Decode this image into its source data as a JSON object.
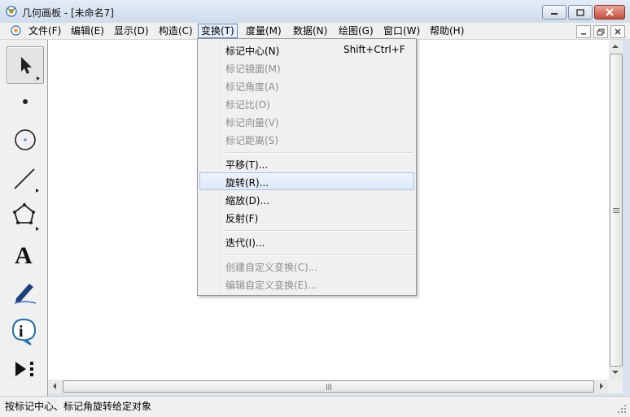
{
  "window": {
    "title": "几何画板 - [未命名7]"
  },
  "menubar": {
    "items": [
      "文件(F)",
      "编辑(E)",
      "显示(D)",
      "构造(C)",
      "变换(T)",
      "度量(M)",
      "数据(N)",
      "绘图(G)",
      "窗口(W)",
      "帮助(H)"
    ],
    "active_index": 4
  },
  "toolbar": {
    "tools": [
      "selection-arrow",
      "point",
      "compass",
      "straightedge",
      "polygon",
      "text",
      "marker",
      "information",
      "custom"
    ],
    "selected": "selection-arrow",
    "text_tool_glyph": "A",
    "info_tool_glyph": "i"
  },
  "transform_menu": {
    "items": [
      {
        "label": "标记中心(N)",
        "shortcut": "Shift+Ctrl+F",
        "enabled": true
      },
      {
        "label": "标记镜面(M)",
        "enabled": false
      },
      {
        "label": "标记角度(A)",
        "enabled": false
      },
      {
        "label": "标记比(O)",
        "enabled": false
      },
      {
        "label": "标记向量(V)",
        "enabled": false
      },
      {
        "label": "标记距离(S)",
        "enabled": false
      },
      {
        "label": "平移(T)...",
        "enabled": true
      },
      {
        "label": "旋转(R)...",
        "enabled": true,
        "highlighted": true
      },
      {
        "label": "缩放(D)...",
        "enabled": true
      },
      {
        "label": "反射(F)",
        "enabled": true
      },
      {
        "label": "迭代(I)...",
        "enabled": true
      },
      {
        "label": "创建自定义变换(C)...",
        "enabled": false
      },
      {
        "label": "编辑自定义变换(E)...",
        "enabled": false
      }
    ]
  },
  "statusbar": {
    "text": "按标记中心、标记角旋转给定对象"
  },
  "colors": {
    "title_bar": "#d9e3ef",
    "close_button": "#c84d3a",
    "menu_highlight": "#dde9f8",
    "disabled_text": "#8d8d8d"
  }
}
